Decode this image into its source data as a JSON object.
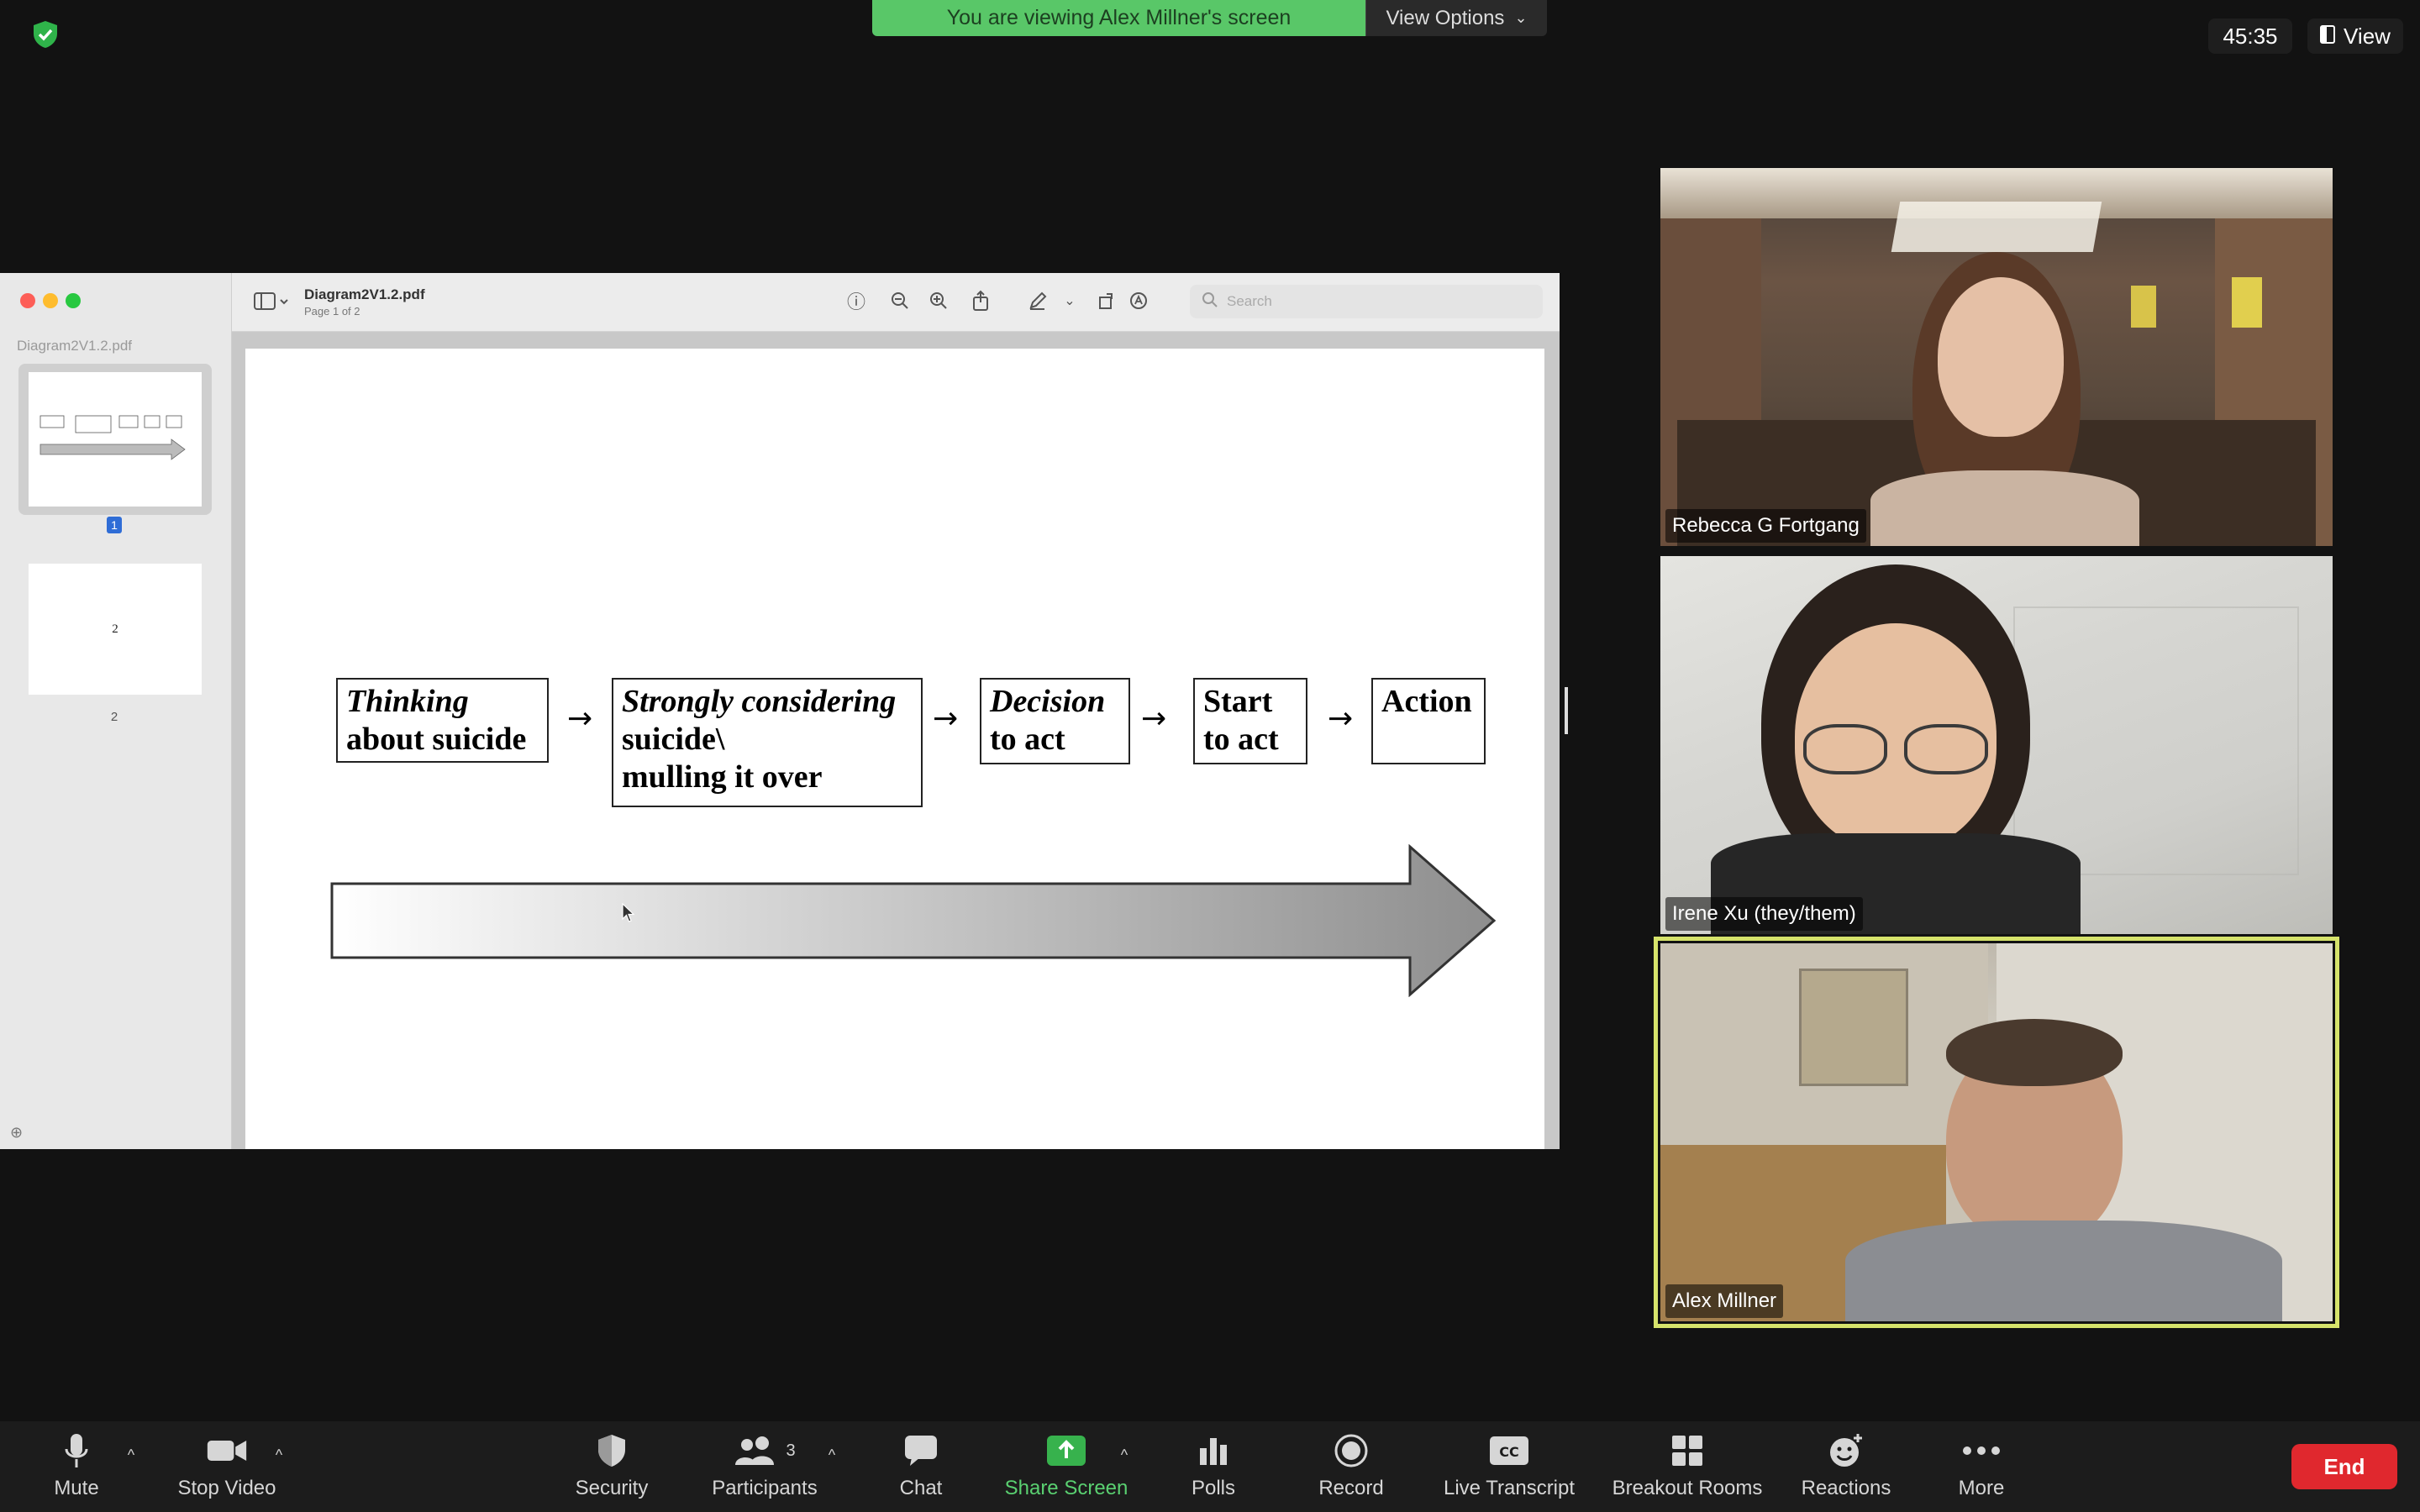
{
  "top_bar": {
    "viewing_banner": "You are viewing Alex Millner's screen",
    "view_options_label": "View Options",
    "timer": "45:35",
    "view_label": "View"
  },
  "preview": {
    "sidebar_filename": "Diagram2V1.2.pdf",
    "thumbnails": [
      {
        "page_number": "1"
      },
      {
        "page_number": "2",
        "content": "2"
      }
    ],
    "title": "Diagram2V1.2.pdf",
    "subtitle": "Page 1 of 2",
    "search_placeholder": "Search"
  },
  "diagram": {
    "boxes": [
      {
        "lines": [
          "Thinking",
          "about suicide"
        ],
        "italic_first": true
      },
      {
        "lines": [
          "Strongly considering",
          "suicide\\",
          "mulling it over"
        ],
        "italic_first": true
      },
      {
        "lines": [
          "Decision",
          "to act"
        ],
        "italic_first": true
      },
      {
        "lines": [
          "Start",
          "to act"
        ],
        "italic_first": false
      },
      {
        "lines": [
          "Action"
        ],
        "italic_first": false
      }
    ],
    "arrow_glyph": "→"
  },
  "participants": [
    {
      "name": "Rebecca G Fortgang"
    },
    {
      "name": "Irene Xu (they/them)"
    },
    {
      "name": "Alex Millner",
      "active_speaker": true
    }
  ],
  "toolbar": {
    "mute": "Mute",
    "stop_video": "Stop Video",
    "security": "Security",
    "participants": "Participants",
    "participants_count": "3",
    "chat": "Chat",
    "share_screen": "Share Screen",
    "polls": "Polls",
    "record": "Record",
    "live_transcript": "Live Transcript",
    "breakout_rooms": "Breakout Rooms",
    "reactions": "Reactions",
    "more": "More",
    "end": "End"
  },
  "colors": {
    "banner_green": "#59c768",
    "share_green": "#37b24d",
    "end_red": "#e0282e",
    "active_speaker_border": "#d6e36b"
  }
}
